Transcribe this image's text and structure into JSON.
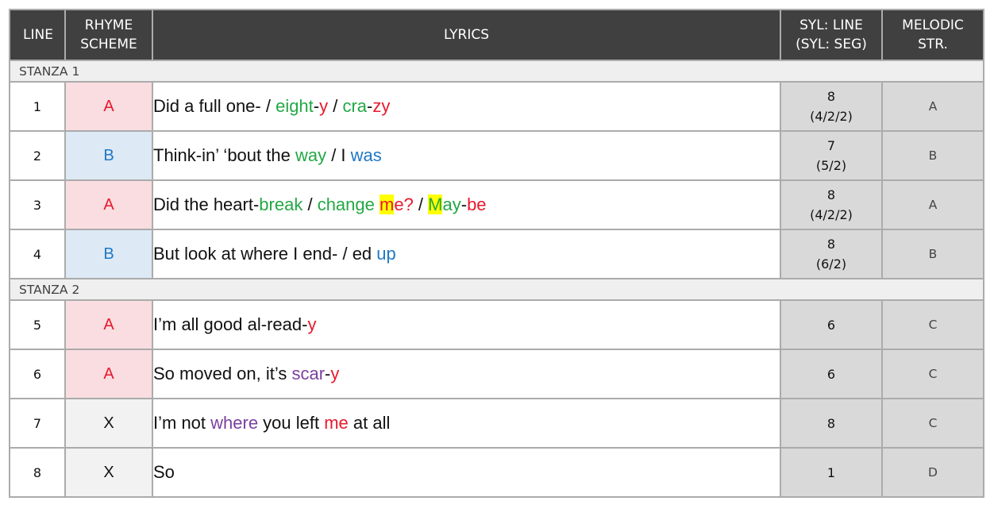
{
  "headers": {
    "line": "LINE",
    "rhyme_1": "RHYME",
    "rhyme_2": "SCHEME",
    "lyrics": "LYRICS",
    "syl_1": "SYL: LINE",
    "syl_2": "(SYL: SEG)",
    "mel_1": "MELODIC",
    "mel_2": "STR."
  },
  "colors": {
    "green": "#23a845",
    "red": "#e8192c",
    "blue": "#1f78c4",
    "purple": "#7b3fa0",
    "highlight": "#ffff00",
    "header_bg": "#404040",
    "rhyme_a_bg": "#f9dde1",
    "rhyme_b_bg": "#dde9f5",
    "rhyme_x_bg": "#f2f2f2",
    "syl_bg": "#d9d9d9"
  },
  "stanzas": [
    {
      "label": "STANZA 1",
      "rows": [
        {
          "line": "1",
          "rhyme": "A",
          "lyric": [
            {
              "t": "Did a full one- / "
            },
            {
              "t": "eight",
              "c": "green"
            },
            {
              "t": "-"
            },
            {
              "t": "y",
              "c": "red"
            },
            {
              "t": " / "
            },
            {
              "t": "cra",
              "c": "green"
            },
            {
              "t": "-"
            },
            {
              "t": "zy",
              "c": "red"
            }
          ],
          "syl_line": "8",
          "syl_seg": "(4/2/2)",
          "melodic": "A"
        },
        {
          "line": "2",
          "rhyme": "B",
          "lyric": [
            {
              "t": "Think-in’ ‘bout the "
            },
            {
              "t": "way",
              "c": "green"
            },
            {
              "t": " / I "
            },
            {
              "t": "was",
              "c": "blue"
            }
          ],
          "syl_line": "7",
          "syl_seg": "(5/2)",
          "melodic": "B"
        },
        {
          "line": "3",
          "rhyme": "A",
          "lyric": [
            {
              "t": "Did the heart-"
            },
            {
              "t": "break",
              "c": "green"
            },
            {
              "t": " / "
            },
            {
              "t": "change",
              "c": "green"
            },
            {
              "t": " "
            },
            {
              "t": "m",
              "c": "red",
              "hl": true
            },
            {
              "t": "e?",
              "c": "red"
            },
            {
              "t": " / "
            },
            {
              "t": "M",
              "c": "green",
              "hl": true
            },
            {
              "t": "ay",
              "c": "green"
            },
            {
              "t": "-"
            },
            {
              "t": "be",
              "c": "red"
            }
          ],
          "syl_line": "8",
          "syl_seg": "(4/2/2)",
          "melodic": "A"
        },
        {
          "line": "4",
          "rhyme": "B",
          "lyric": [
            {
              "t": "But look at where I end- / ed "
            },
            {
              "t": "up",
              "c": "blue"
            }
          ],
          "syl_line": "8",
          "syl_seg": "(6/2)",
          "melodic": "B"
        }
      ]
    },
    {
      "label": "STANZA 2",
      "rows": [
        {
          "line": "5",
          "rhyme": "A",
          "lyric": [
            {
              "t": "I’m all good al-read-"
            },
            {
              "t": "y",
              "c": "red"
            }
          ],
          "syl_line": "6",
          "syl_seg": "",
          "melodic": "C"
        },
        {
          "line": "6",
          "rhyme": "A",
          "lyric": [
            {
              "t": "So moved on, it’s "
            },
            {
              "t": "scar",
              "c": "purple"
            },
            {
              "t": "-"
            },
            {
              "t": "y",
              "c": "red"
            }
          ],
          "syl_line": "6",
          "syl_seg": "",
          "melodic": "C"
        },
        {
          "line": "7",
          "rhyme": "X",
          "lyric": [
            {
              "t": "I’m not "
            },
            {
              "t": "where",
              "c": "purple"
            },
            {
              "t": " you left "
            },
            {
              "t": "me",
              "c": "red"
            },
            {
              "t": " at all"
            }
          ],
          "syl_line": "8",
          "syl_seg": "",
          "melodic": "C"
        },
        {
          "line": "8",
          "rhyme": "X",
          "lyric": [
            {
              "t": "So"
            }
          ],
          "syl_line": "1",
          "syl_seg": "",
          "melodic": "D"
        }
      ]
    }
  ]
}
